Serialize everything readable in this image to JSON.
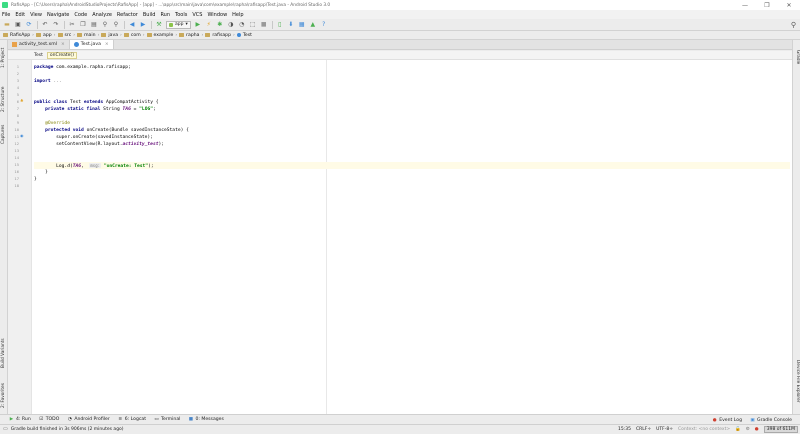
{
  "window": {
    "title": "RafisApp - [C:\\Users\\rapha\\AndroidStudioProjects\\RafisApp] - [app] - ...\\app\\src\\main\\java\\com\\example\\rapha\\rafisapp\\Test.java - Android Studio 3.0",
    "controls": [
      "—",
      "❐",
      "✕"
    ]
  },
  "menu": [
    "File",
    "Edit",
    "View",
    "Navigate",
    "Code",
    "Analyze",
    "Refactor",
    "Build",
    "Run",
    "Tools",
    "VCS",
    "Window",
    "Help"
  ],
  "toolbar": {
    "run_config": "app"
  },
  "breadcrumbs": [
    "RafisApp",
    "app",
    "src",
    "main",
    "java",
    "com",
    "example",
    "rapha",
    "rafisapp",
    "Test"
  ],
  "tabs": [
    {
      "label": "activity_test.xml",
      "active": false
    },
    {
      "label": "Test.java",
      "active": true
    }
  ],
  "structure_crumbs": [
    "Test",
    "onCreate()"
  ],
  "left_tools": [
    "1: Project",
    "2: Structure",
    "Captures",
    "Build Variants",
    "2: Favorites"
  ],
  "right_tools": [
    "Gradle",
    "Device File Explorer"
  ],
  "editor": {
    "line_numbers": [
      "1",
      "2",
      "3",
      "4",
      "5",
      "6",
      "7",
      "8",
      "9",
      "10",
      "11",
      "12",
      "13",
      "14",
      "15",
      "16",
      "17",
      "18"
    ],
    "current_line": 15,
    "lines": {
      "l1_kw": "package",
      "l1_rest": " com.example.rapha.rafisapp;",
      "l3_kw": "import",
      "l3_rest": " ...",
      "l6_kw1": "public class",
      "l6_mid": " Test ",
      "l6_kw2": "extends",
      "l6_rest": " AppCompatActivity {",
      "l7_kw": "    private static final",
      "l7_mid": " String ",
      "l7_fld": "TAG",
      "l7_eq": " = ",
      "l7_str": "\"LOG\"",
      "l7_end": ";",
      "l9_ann": "    @Override",
      "l10_kw": "    protected void",
      "l10_rest": " onCreate(Bundle savedInstanceState) {",
      "l11": "        super.onCreate(savedInstanceState);",
      "l12_a": "        setContentView(R.layout.",
      "l12_fld": "activity_test",
      "l12_b": ");",
      "l15_a": "        Log.",
      "l15_i": "d",
      "l15_b": "(",
      "l15_fld": "TAG",
      "l15_c": ",  ",
      "l15_hint": "msg:",
      "l15_d": " ",
      "l15_str": "\"onCreate: Test\"",
      "l15_e": ");",
      "l16": "    }",
      "l17": "}"
    }
  },
  "bottom_tools": [
    {
      "icon": "▶",
      "label": "4: Run",
      "color": "#4caf50"
    },
    {
      "icon": "☑",
      "label": "TODO",
      "color": "#555555"
    },
    {
      "icon": "◔",
      "label": "Android Profiler",
      "color": "#555555"
    },
    {
      "icon": "≡",
      "label": "6: Logcat",
      "color": "#555555"
    },
    {
      "icon": "▭",
      "label": "Terminal",
      "color": "#555555"
    },
    {
      "icon": "■",
      "label": "0: Messages",
      "color": "#4a86c8"
    }
  ],
  "bottom_right_tools": [
    {
      "icon": "●",
      "label": "Event Log",
      "color": "#d04030"
    },
    {
      "icon": "▣",
      "label": "Gradle Console",
      "color": "#3f8ad8"
    }
  ],
  "status": {
    "message": "Gradle build finished in 3s 906ms (2 minutes ago)",
    "position": "15:35",
    "line_sep": "CRLF÷",
    "encoding": "UTF-8÷",
    "context": "Context: <no context>",
    "memory": "398 of 611M"
  }
}
